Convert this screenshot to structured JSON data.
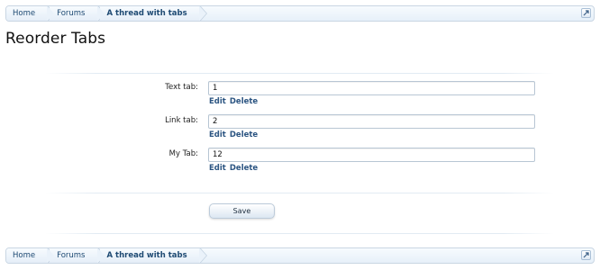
{
  "breadcrumb": {
    "items": [
      {
        "label": "Home"
      },
      {
        "label": "Forums"
      },
      {
        "label": "A thread with tabs"
      }
    ],
    "jump_icon": "jump-to-icon"
  },
  "page": {
    "title": "Reorder Tabs"
  },
  "form": {
    "rows": [
      {
        "label": "Text tab:",
        "value": "1",
        "edit": "Edit",
        "delete": "Delete"
      },
      {
        "label": "Link tab:",
        "value": "2",
        "edit": "Edit",
        "delete": "Delete"
      },
      {
        "label": "My Tab:",
        "value": "12",
        "edit": "Edit",
        "delete": "Delete"
      }
    ],
    "save_label": "Save"
  },
  "colors": {
    "link": "#2c5582",
    "breadcrumb_text": "#1e4a73",
    "border": "#c9d6e3"
  }
}
